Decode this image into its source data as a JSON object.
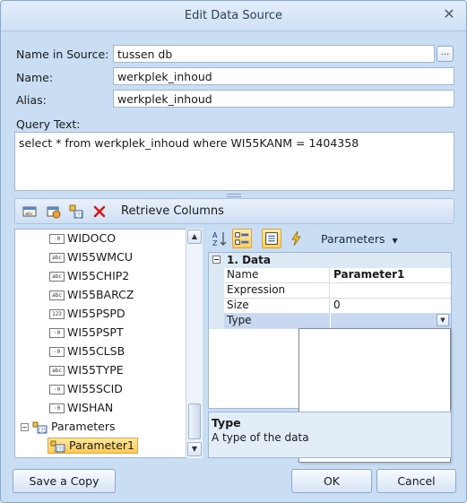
{
  "window": {
    "title": "Edit Data Source"
  },
  "fields": {
    "name_in_source": {
      "label": "Name in Source:",
      "value": "tussen db"
    },
    "name": {
      "label": "Name:",
      "value": "werkplek_inhoud"
    },
    "alias": {
      "label": "Alias:",
      "value": "werkplek_inhoud"
    },
    "ellipsis_label": "..."
  },
  "query": {
    "label": "Query Text:",
    "value": "select * from werkplek_inhoud where WI55KANM = 1404358"
  },
  "toolbar": {
    "retrieve_label": "Retrieve Columns"
  },
  "tree": {
    "columns": [
      {
        "label": "WIDOCO",
        "type_badge": ""
      },
      {
        "label": "WI55WMCU",
        "type_badge": "abc"
      },
      {
        "label": "WI55CHIP2",
        "type_badge": "abc"
      },
      {
        "label": "WI55BARCZ",
        "type_badge": "abc"
      },
      {
        "label": "WI55PSPD",
        "type_badge": "123"
      },
      {
        "label": "WI55PSPT",
        "type_badge": ""
      },
      {
        "label": "WI55CLSB",
        "type_badge": ""
      },
      {
        "label": "WI55TYPE",
        "type_badge": "abc"
      },
      {
        "label": "WI55SCID",
        "type_badge": ""
      },
      {
        "label": "WISHAN",
        "type_badge": ""
      }
    ],
    "parameters_label": "Parameters",
    "parameter_item": "Parameter1"
  },
  "properties": {
    "toolbar_label": "Parameters",
    "category": "1. Data",
    "rows": [
      {
        "name": "Name",
        "value": "Parameter1"
      },
      {
        "name": "Expression",
        "value": ""
      },
      {
        "name": "Size",
        "value": "0"
      },
      {
        "name": "Type",
        "value": ""
      }
    ],
    "description_title": "Type",
    "description_text": "A type of the data"
  },
  "buttons": {
    "save_copy": "Save a Copy",
    "ok": "OK",
    "cancel": "Cancel"
  }
}
